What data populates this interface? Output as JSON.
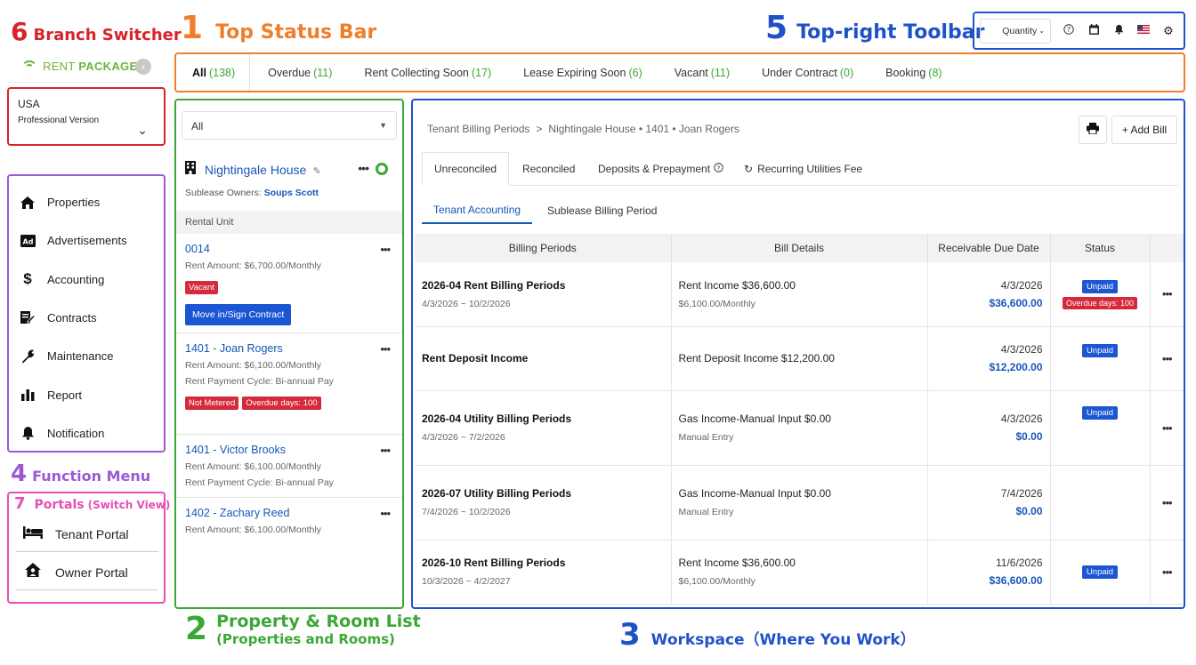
{
  "annotations": {
    "branch_switcher": {
      "num": "6",
      "text": "Branch Switcher",
      "color": "#d8232a"
    },
    "top_status_bar": {
      "num": "1",
      "text": "Top Status Bar",
      "color": "#f07f2b"
    },
    "toolbar": {
      "num": "5",
      "text": "Top-right Toolbar",
      "color": "#1f52c9"
    },
    "function_menu": {
      "num": "4",
      "text": "Function Menu",
      "color": "#9b59d6"
    },
    "portals": {
      "num": "7",
      "text": "Portals",
      "sub": "(Switch View)",
      "color": "#e84fb3"
    },
    "property_list": {
      "num": "2",
      "text": "Property & Room List",
      "sub": "(Properties and Rooms)",
      "color": "#3aa835"
    },
    "workspace": {
      "num": "3",
      "text": "Workspace（Where You Work）",
      "color": "#1f52c9"
    }
  },
  "brand": {
    "name_a": "RENT",
    "name_b": "PACKAGE",
    "color": "#6db33f"
  },
  "branch": {
    "country": "USA",
    "version": "Professional Version"
  },
  "menu": [
    {
      "label": "Properties",
      "icon": "home-icon"
    },
    {
      "label": "Advertisements",
      "icon": "ad-icon"
    },
    {
      "label": "Accounting",
      "icon": "dollar-icon"
    },
    {
      "label": "Contracts",
      "icon": "contract-icon"
    },
    {
      "label": "Maintenance",
      "icon": "wrench-icon"
    },
    {
      "label": "Report",
      "icon": "bar-chart-icon"
    },
    {
      "label": "Notification",
      "icon": "bell-icon"
    }
  ],
  "portals": [
    {
      "label": "Tenant Portal",
      "icon": "bed-icon"
    },
    {
      "label": "Owner Portal",
      "icon": "house-person-icon"
    }
  ],
  "status_tabs": [
    {
      "label": "All",
      "count": "(138)"
    },
    {
      "label": "Overdue",
      "count": "(11)"
    },
    {
      "label": "Rent Collecting Soon",
      "count": "(17)"
    },
    {
      "label": "Lease Expiring Soon",
      "count": "(6)"
    },
    {
      "label": "Vacant",
      "count": "(11)"
    },
    {
      "label": "Under Contract",
      "count": "(0)"
    },
    {
      "label": "Booking",
      "count": "(8)"
    }
  ],
  "toolbar": {
    "quantity_label": "Quantity",
    "icons": [
      "help-icon",
      "calendar-icon",
      "bell-icon",
      "us-flag-icon",
      "gear-icon"
    ]
  },
  "property_list": {
    "filter": "All",
    "property_name": "Nightingale House",
    "owners_label": "Sublease Owners:",
    "owners_value": "Soups Scott",
    "rental_unit_header": "Rental Unit",
    "rooms": [
      {
        "name": "0014",
        "lines": [
          "Rent Amount: $6,700.00/Monthly"
        ],
        "tags": [
          "Vacant"
        ],
        "button": "Move in/Sign Contract"
      },
      {
        "name": "1401 - Joan Rogers",
        "lines": [
          "Rent Amount: $6,100.00/Monthly",
          "Rent Payment Cycle: Bi-annual Pay"
        ],
        "tags": [
          "Not Metered",
          "Overdue days: 100"
        ]
      },
      {
        "name": "1401 - Victor Brooks",
        "lines": [
          "Rent Amount: $6,100.00/Monthly",
          "Rent Payment Cycle: Bi-annual Pay"
        ],
        "tags": []
      },
      {
        "name": "1402 - Zachary Reed",
        "lines": [
          "Rent Amount: $6,100.00/Monthly"
        ],
        "tags": []
      }
    ]
  },
  "workspace": {
    "breadcrumb": [
      "Tenant Billing Periods",
      "Nightingale House • 1401 • Joan Rogers"
    ],
    "breadcrumb_sep": ">",
    "print_icon": "printer-icon",
    "add_bill": "+ Add Bill",
    "tabs": [
      "Unreconciled",
      "Reconciled",
      "Deposits & Prepayment",
      "Recurring Utilities Fee"
    ],
    "subtabs": [
      "Tenant Accounting",
      "Sublease Billing Period"
    ],
    "columns": [
      "Billing Periods",
      "Bill Details",
      "Receivable Due Date",
      "Status"
    ],
    "rows": [
      {
        "title": "2026-04 Rent Billing Periods",
        "range": "4/3/2026 ~ 10/2/2026",
        "detail": "Rent Income  $36,600.00",
        "detail_sub": "$6,100.00/Monthly",
        "due": "4/3/2026",
        "amount": "$36,600.00",
        "status": "Unpaid",
        "overdue": "Overdue days: 100"
      },
      {
        "title": "Rent Deposit Income",
        "range": "",
        "detail": "Rent Deposit Income  $12,200.00",
        "detail_sub": "",
        "due": "4/3/2026",
        "amount": "$12,200.00",
        "status": "Unpaid",
        "overdue": ""
      },
      {
        "title": "2026-04 Utility Billing Periods",
        "range": "4/3/2026 ~ 7/2/2026",
        "detail": "Gas Income-Manual Input  $0.00",
        "detail_sub": "Manual Entry",
        "due": "4/3/2026",
        "amount": "$0.00",
        "status": "Unpaid",
        "overdue": ""
      },
      {
        "title": "2026-07 Utility Billing Periods",
        "range": "7/4/2026 ~ 10/2/2026",
        "detail": "Gas Income-Manual Input  $0.00",
        "detail_sub": "Manual Entry",
        "due": "7/4/2026",
        "amount": "$0.00",
        "status": "",
        "overdue": ""
      },
      {
        "title": "2026-10 Rent Billing Periods",
        "range": "10/3/2026 ~ 4/2/2027",
        "detail": "Rent Income  $36,600.00",
        "detail_sub": "$6,100.00/Monthly",
        "due": "11/6/2026",
        "amount": "$36,600.00",
        "status": "Unpaid",
        "overdue": ""
      }
    ]
  }
}
